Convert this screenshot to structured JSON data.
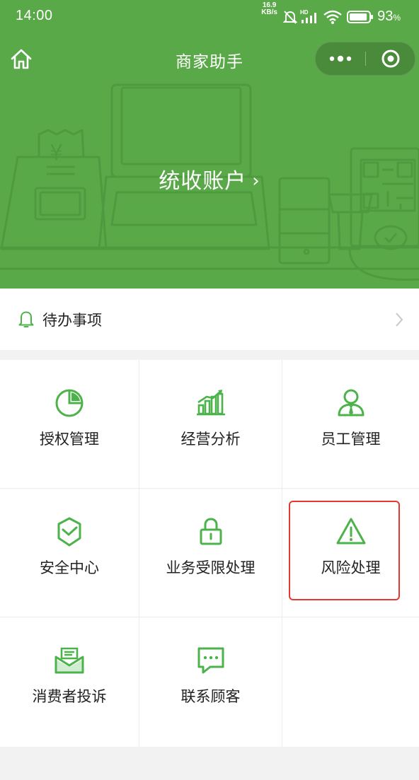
{
  "status_bar": {
    "time": "14:00",
    "network_speed_value": "16.9",
    "network_speed_unit": "KB/s",
    "battery_percent": "93",
    "battery_level": 0.93,
    "icons": [
      "mute-bell-icon",
      "hd-signal-icon",
      "wifi-icon",
      "battery-icon"
    ]
  },
  "nav": {
    "title": "商家助手",
    "home_icon": "home-icon",
    "more_icon": "more-dots-icon",
    "close_icon": "record-close-icon"
  },
  "hero": {
    "account_link_label": "统收账户",
    "account_link_chevron": "›",
    "illustration_glyph": "¥",
    "background_color": "#5aa949"
  },
  "todo": {
    "label": "待办事项",
    "icon": "bell-icon",
    "arrow_icon": "chevron-right-icon"
  },
  "grid": {
    "items": [
      {
        "label": "授权管理",
        "icon": "pie-chart-icon"
      },
      {
        "label": "经营分析",
        "icon": "bar-chart-icon"
      },
      {
        "label": "员工管理",
        "icon": "staff-icon"
      },
      {
        "label": "安全中心",
        "icon": "shield-check-icon"
      },
      {
        "label": "业务受限处理",
        "icon": "lock-icon"
      },
      {
        "label": "风险处理",
        "icon": "warning-icon"
      },
      {
        "label": "消费者投诉",
        "icon": "complaint-mail-icon"
      },
      {
        "label": "联系顾客",
        "icon": "chat-bubble-icon"
      }
    ],
    "highlighted_item": "风险处理",
    "accent_color": "#4cb34a",
    "highlight_color": "#e5392f"
  }
}
